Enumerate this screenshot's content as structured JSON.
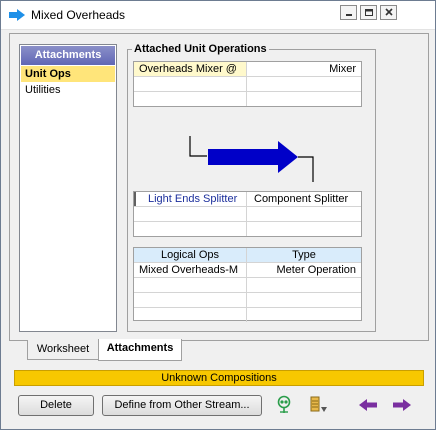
{
  "window": {
    "title": "Mixed Overheads"
  },
  "sidebar": {
    "header": "Attachments",
    "items": [
      {
        "label": "Unit Ops",
        "selected": true
      },
      {
        "label": "Utilities",
        "selected": false
      }
    ]
  },
  "attached": {
    "label": "Attached Unit Operations",
    "top_grid": {
      "rows": [
        {
          "name": "Overheads Mixer @",
          "type": "Mixer"
        }
      ]
    },
    "mid_grid": {
      "rows": [
        {
          "name": "Light Ends Splitter",
          "type": "Component Splitter"
        }
      ]
    },
    "logical": {
      "headers": {
        "name": "Logical Ops",
        "type": "Type"
      },
      "rows": [
        {
          "name": "Mixed Overheads-M",
          "type": "Meter Operation"
        }
      ]
    }
  },
  "tabs": [
    {
      "label": "Worksheet",
      "active": false
    },
    {
      "label": "Attachments",
      "active": true
    }
  ],
  "status": {
    "text": "Unknown Compositions",
    "color": "#f7c800"
  },
  "buttons": {
    "delete": "Delete",
    "define": "Define from Other Stream..."
  },
  "colors": {
    "stream_arrow": "#0000c8",
    "nav_arrows": "#7a2fa0",
    "sidebar_header": "#6167b5"
  },
  "icons": [
    "stream-arrow-icon",
    "minimize-icon",
    "restore-icon",
    "close-icon",
    "feed-status-icon",
    "stream-list-icon",
    "previous-arrow-icon",
    "next-arrow-icon"
  ]
}
